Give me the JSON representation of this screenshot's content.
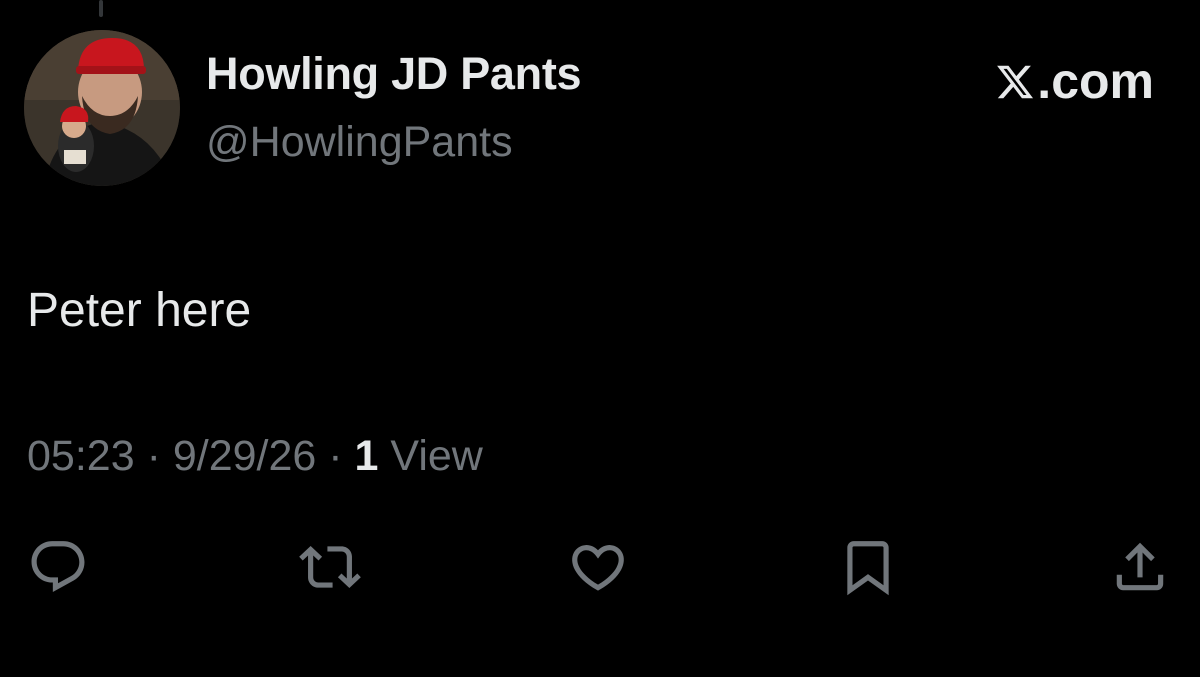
{
  "tweet": {
    "author": {
      "display_name": "Howling JD Pants",
      "handle": "@HowlingPants",
      "avatar": "avatar-photo"
    },
    "watermark": {
      "icon": "x-logo-icon",
      "text": ".com"
    },
    "text": "Peter here",
    "meta": {
      "time": "05:23",
      "separator": "·",
      "date": "9/29/26",
      "views_count": "1",
      "views_label": "View"
    },
    "actions": [
      {
        "name": "reply",
        "icon": "reply-icon"
      },
      {
        "name": "repost",
        "icon": "repost-icon"
      },
      {
        "name": "like",
        "icon": "heart-icon"
      },
      {
        "name": "bookmark",
        "icon": "bookmark-icon"
      },
      {
        "name": "share",
        "icon": "share-icon"
      }
    ]
  },
  "colors": {
    "background": "#000000",
    "primary_text": "#e7e9ea",
    "secondary_text": "#71767b",
    "icon": "#71767b"
  }
}
